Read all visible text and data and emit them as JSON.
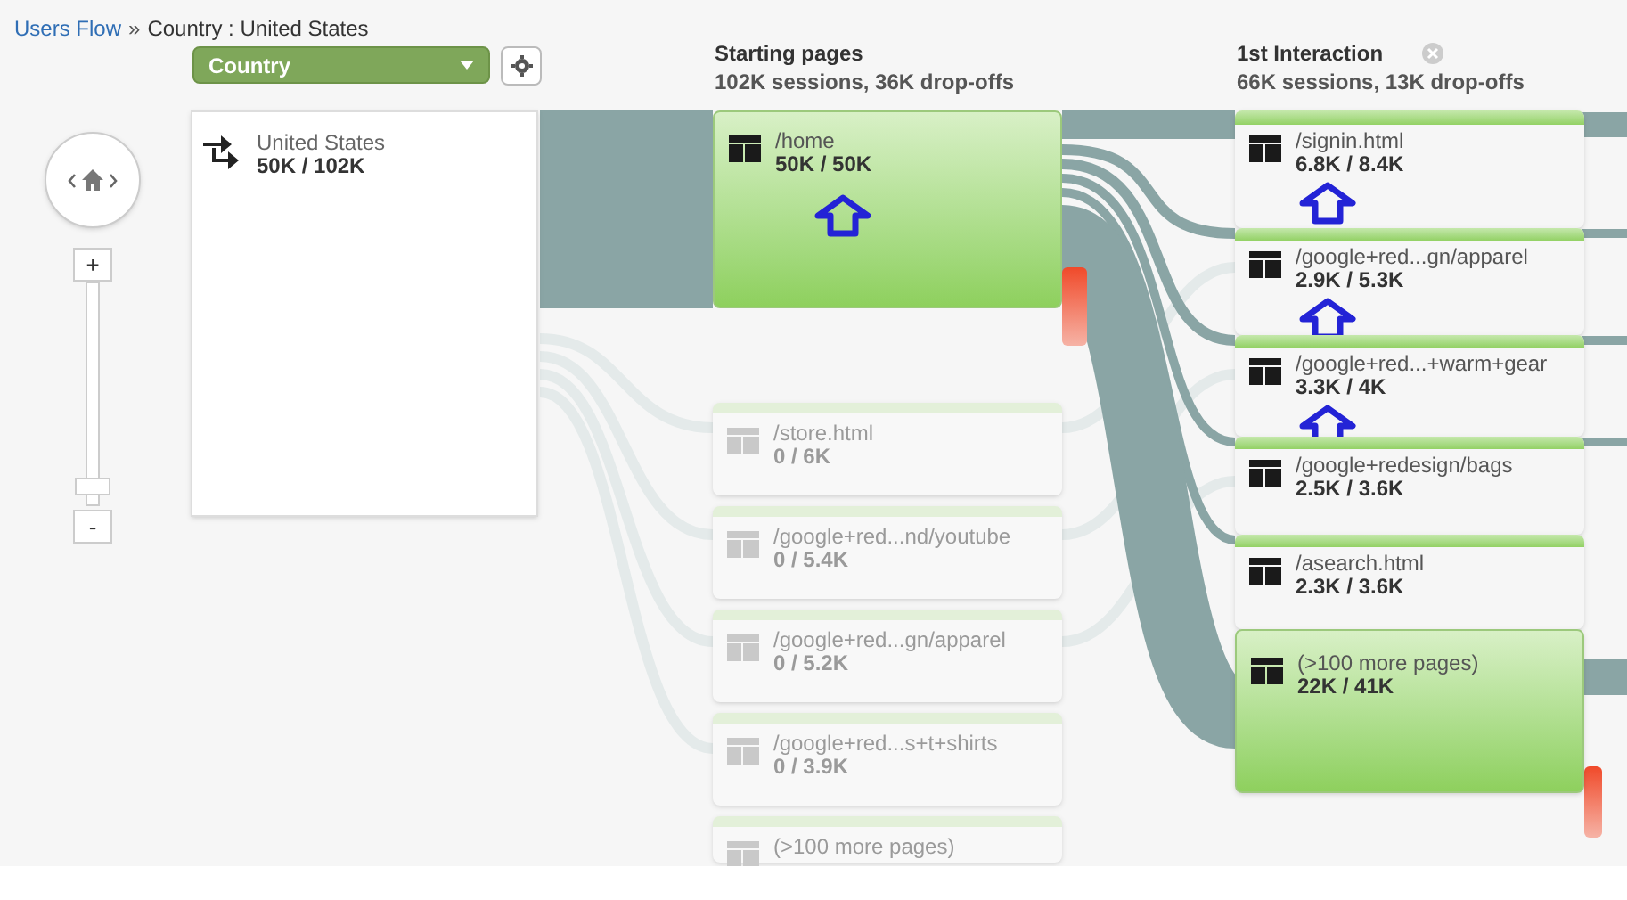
{
  "breadcrumb": {
    "link": "Users Flow",
    "separator": "»",
    "current": "Country : United States"
  },
  "dimension_select": {
    "value": "Country"
  },
  "zoom": {
    "in_label": "+",
    "out_label": "-",
    "level": 0.04
  },
  "source_node": {
    "label": "United States",
    "counts": "50K / 102K"
  },
  "columns": [
    {
      "title": "Starting pages",
      "summary": "102K sessions, 36K drop-offs",
      "closable": false
    },
    {
      "title": "1st Interaction",
      "summary": "66K sessions, 13K drop-offs",
      "closable": true
    }
  ],
  "starting_pages": [
    {
      "label": "/home",
      "counts": "50K / 50K",
      "dimmed": false,
      "annotation_arrow": true
    },
    {
      "label": "/store.html",
      "counts": "0 / 6K",
      "dimmed": true,
      "annotation_arrow": false
    },
    {
      "label": "/google+red...nd/youtube",
      "counts": "0 / 5.4K",
      "dimmed": true,
      "annotation_arrow": false
    },
    {
      "label": "/google+red...gn/apparel",
      "counts": "0 / 5.2K",
      "dimmed": true,
      "annotation_arrow": false
    },
    {
      "label": "/google+red...s+t+shirts",
      "counts": "0 / 3.9K",
      "dimmed": true,
      "annotation_arrow": false
    },
    {
      "label": "(>100 more pages)",
      "dimmed": true,
      "annotation_arrow": false
    }
  ],
  "interaction_pages": [
    {
      "label": "/signin.html",
      "counts": "6.8K / 8.4K",
      "annotation_arrow": true
    },
    {
      "label": "/google+red...gn/apparel",
      "counts": "2.9K / 5.3K",
      "annotation_arrow": true
    },
    {
      "label": "/google+red...+warm+gear",
      "counts": "3.3K / 4K",
      "annotation_arrow": true
    },
    {
      "label": "/google+redesign/bags",
      "counts": "2.5K / 3.6K",
      "annotation_arrow": false
    },
    {
      "label": "/asearch.html",
      "counts": "2.3K / 3.6K",
      "annotation_arrow": false
    },
    {
      "label": "(>100 more pages)",
      "counts": "22K / 41K",
      "annotation_arrow": false
    }
  ]
}
